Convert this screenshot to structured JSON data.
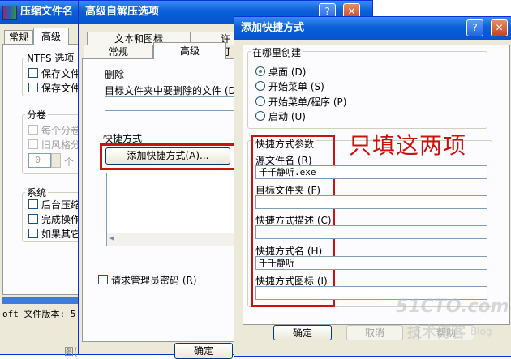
{
  "back_window": {
    "title": "压缩文件名",
    "tabs": [
      "常规",
      "高级"
    ],
    "ntfs_group": "NTFS 选项",
    "ntfs_items": [
      "保存文件",
      "保存文件"
    ],
    "split_group": "分卷",
    "split_items": [
      "每个分卷",
      "旧风格分"
    ],
    "spin_value": "0",
    "spin_suffix": "个",
    "system_group": "系统",
    "system_items": [
      "后台压缩",
      "完成操作",
      "如果其它"
    ],
    "status_text": "oft 文件版本: 5.",
    "bottom_text": "图(",
    "close_glyph": "✕"
  },
  "mid_window": {
    "title": "高级自解压选项",
    "tabs_back": [
      "文本和图标",
      "许可"
    ],
    "tabs_front": [
      "常规",
      "高级"
    ],
    "delete_group": "删除",
    "delete_label": "目标文件夹中要删除的文件 (D)",
    "shortcut_label": "快捷方式",
    "add_shortcut_button": "添加快捷方式(A)...",
    "admin_checkbox": "请求管理员密码 (R)",
    "ok_button": "确定",
    "help_glyph": "?",
    "close_glyph": "✕",
    "scroll_left_glyph": "◂"
  },
  "dialog": {
    "title": "添加快捷方式",
    "where_group": "在哪里创建",
    "where_options": [
      "桌面 (D)",
      "开始菜单 (S)",
      "开始菜单/程序 (P)",
      "启动 (U)"
    ],
    "selected_option": 0,
    "params_group": "快捷方式参数",
    "fields": [
      {
        "label": "源文件名 (R)",
        "value": "千千静听.exe"
      },
      {
        "label": "目标文件夹 (F)",
        "value": ""
      },
      {
        "label": "快捷方式描述 (C)",
        "value": ""
      },
      {
        "label": "快捷方式名 (H)",
        "value": "千千静听"
      },
      {
        "label": "快捷方式图标 (I)",
        "value": ""
      }
    ],
    "ok_button": "确定",
    "cancel_button": "取消",
    "help_button": "帮助",
    "help_glyph": "?",
    "close_glyph": "✕"
  },
  "annotation": {
    "text": "只填这两项",
    "color": "#c8140c"
  },
  "watermark": {
    "line1": "51CTO.com",
    "line2": "技术博客",
    "line3": "Blog"
  },
  "colors": {
    "titlebar": "#0a5fd8",
    "window_face": "#ece9d8",
    "highlight_red": "#c8140c"
  }
}
